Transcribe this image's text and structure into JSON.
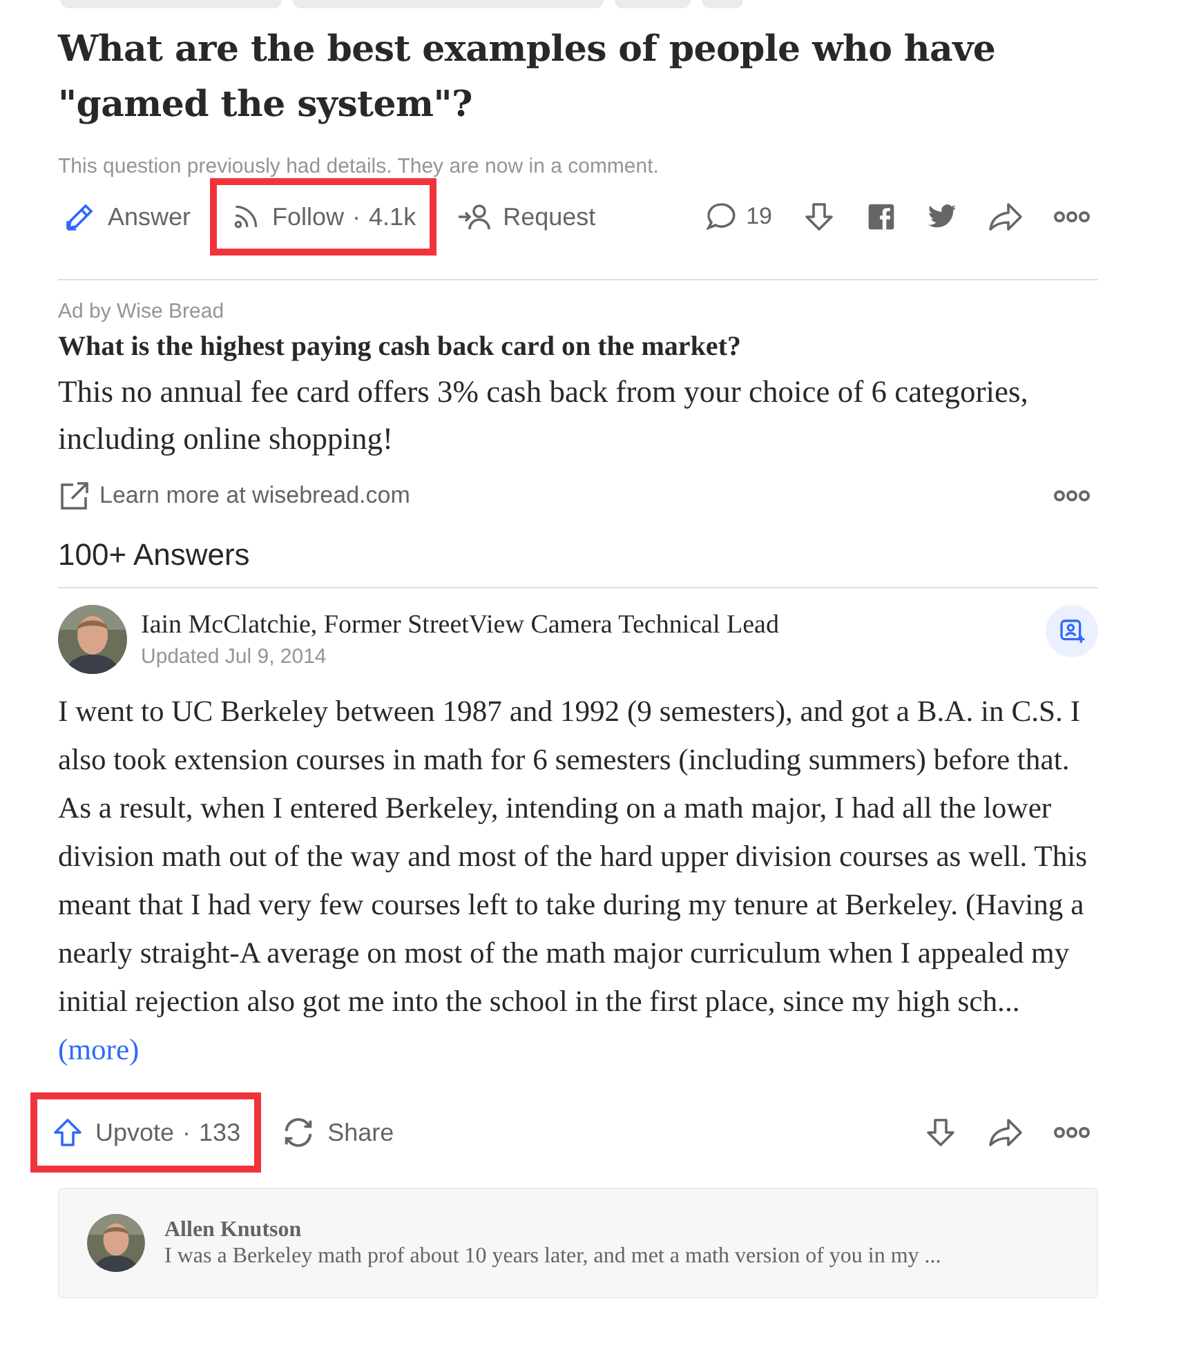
{
  "question": {
    "title": "What are the best examples of people who have \"gamed the system\"?",
    "details_note": "This question previously had details. They are now in a comment."
  },
  "question_actions": [
    {
      "kind": "answer",
      "label": "Answer",
      "highlighted": false
    },
    {
      "kind": "follow",
      "label": "Follow",
      "separator": "·",
      "count": "4.1k",
      "highlighted": true
    },
    {
      "kind": "request",
      "label": "Request",
      "highlighted": false
    }
  ],
  "question_tools": [
    {
      "kind": "comment",
      "count": "19"
    },
    {
      "kind": "downvote"
    },
    {
      "kind": "facebook"
    },
    {
      "kind": "twitter"
    },
    {
      "kind": "share"
    },
    {
      "kind": "more"
    }
  ],
  "ad": {
    "sponsor": "Ad by Wise Bread",
    "headline": "What is the highest paying cash back card on the market?",
    "body": "This no annual fee card offers 3% cash back from your choice of 6 categories, including online shopping!",
    "link": "Learn more at wisebread.com"
  },
  "answers_heading": "100+ Answers",
  "answer": {
    "author": "Iain McClatchie, Former StreetView Camera Technical Lead",
    "date": "Updated Jul 9, 2014",
    "text": "I went to UC Berkeley between 1987 and 1992 (9 semesters), and got a B.A. in C.S. I also took extension courses in math for 6 semesters (including summers) before that. As a result, when I entered Berkeley, intending on a math major, I had all the lower division math out of the way and most of the hard upper division courses as well. This meant that I had very few courses left to take during my tenure at Berkeley. (Having a nearly straight-A average on most of the math major curriculum when I appealed my initial rejection also got me into the school in the first place, since my high sch...",
    "more": "(more)",
    "actions": [
      {
        "kind": "upvote",
        "label": "Upvote",
        "separator": "·",
        "count": "133",
        "highlighted": true
      },
      {
        "kind": "share",
        "label": "Share",
        "highlighted": false
      }
    ],
    "tools": [
      {
        "kind": "downvote"
      },
      {
        "kind": "share"
      },
      {
        "kind": "more"
      }
    ]
  },
  "comment": {
    "author": "Allen Knutson",
    "text": "I was a Berkeley math prof about 10 years later, and met a math version of you in my ..."
  }
}
